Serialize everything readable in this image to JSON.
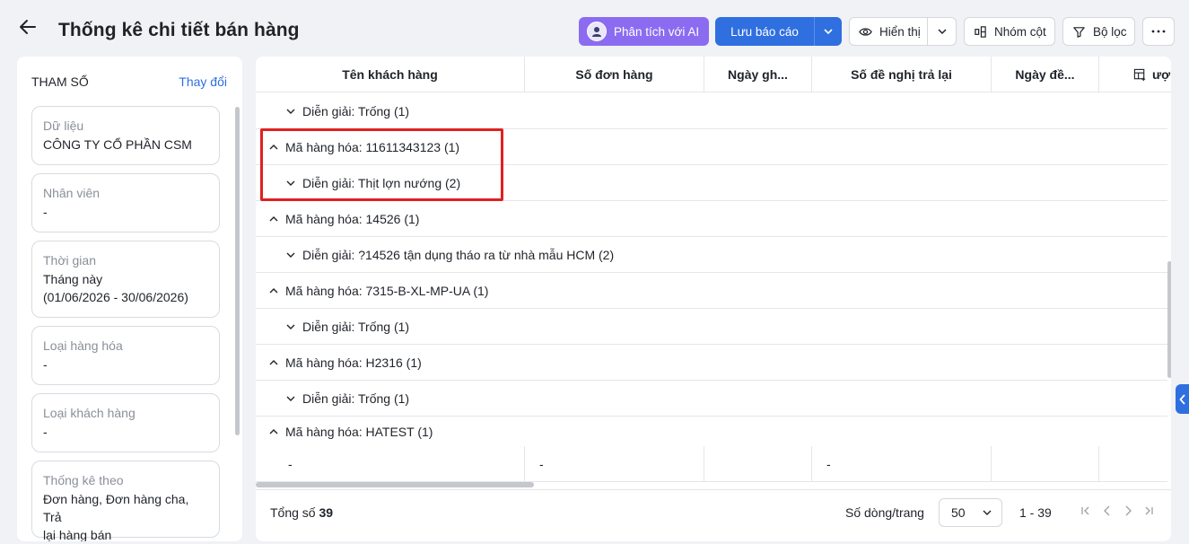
{
  "header": {
    "title": "Thống kê chi tiết bán hàng",
    "ai_label": "Phân tích với AI",
    "save_label": "Lưu báo cáo",
    "display_label": "Hiển thị",
    "group_label": "Nhóm cột",
    "filter_label": "Bộ lọc"
  },
  "params": {
    "heading": "THAM SỐ",
    "change": "Thay đổi",
    "cards": [
      {
        "label": "Dữ liệu",
        "value": "CÔNG TY CỔ PHẦN CSM"
      },
      {
        "label": "Nhân viên",
        "value": "-"
      },
      {
        "label": "Thời gian",
        "value": "Tháng này",
        "value2": "(01/06/2026 - 30/06/2026)"
      },
      {
        "label": "Loại hàng hóa",
        "value": "-"
      },
      {
        "label": "Loại khách hàng",
        "value": "-"
      },
      {
        "label": "Thống kê theo",
        "value": "Đơn hàng, Đơn hàng cha, Trả",
        "value2": "lại hàng bán"
      }
    ]
  },
  "table": {
    "columns": [
      "Tên khách hàng",
      "Số đơn hàng",
      "Ngày gh...",
      "Số đề nghị trả lại",
      "Ngày đề...",
      "ượ"
    ],
    "rows": [
      "Diễn giải: Trống (1)",
      "Mã hàng hóa: 11611343123 (1)",
      "Diễn giải: Thịt lợn nướng (2)",
      "Mã hàng hóa: 14526 (1)",
      "Diễn giải: ?14526 tận dụng tháo ra từ nhà mẫu HCM (2)",
      "Mã hàng hóa: 7315-B-XL-MP-UA (1)",
      "Diễn giải: Trống (1)",
      "Mã hàng hóa: H2316 (1)",
      "Diễn giải: Trống (1)",
      "Mã hàng hóa: HATEST (1)"
    ],
    "data_cells": [
      "-",
      "-",
      "-"
    ]
  },
  "footer": {
    "total_label": "Tổng số",
    "total_value": "39",
    "rows_per_page_label": "Số dòng/trang",
    "rows_per_page": "50",
    "range": "1 - 39"
  },
  "colors": {
    "primary": "#2f6fe0",
    "ai": "#8b6cf0",
    "highlight": "#e02020"
  }
}
